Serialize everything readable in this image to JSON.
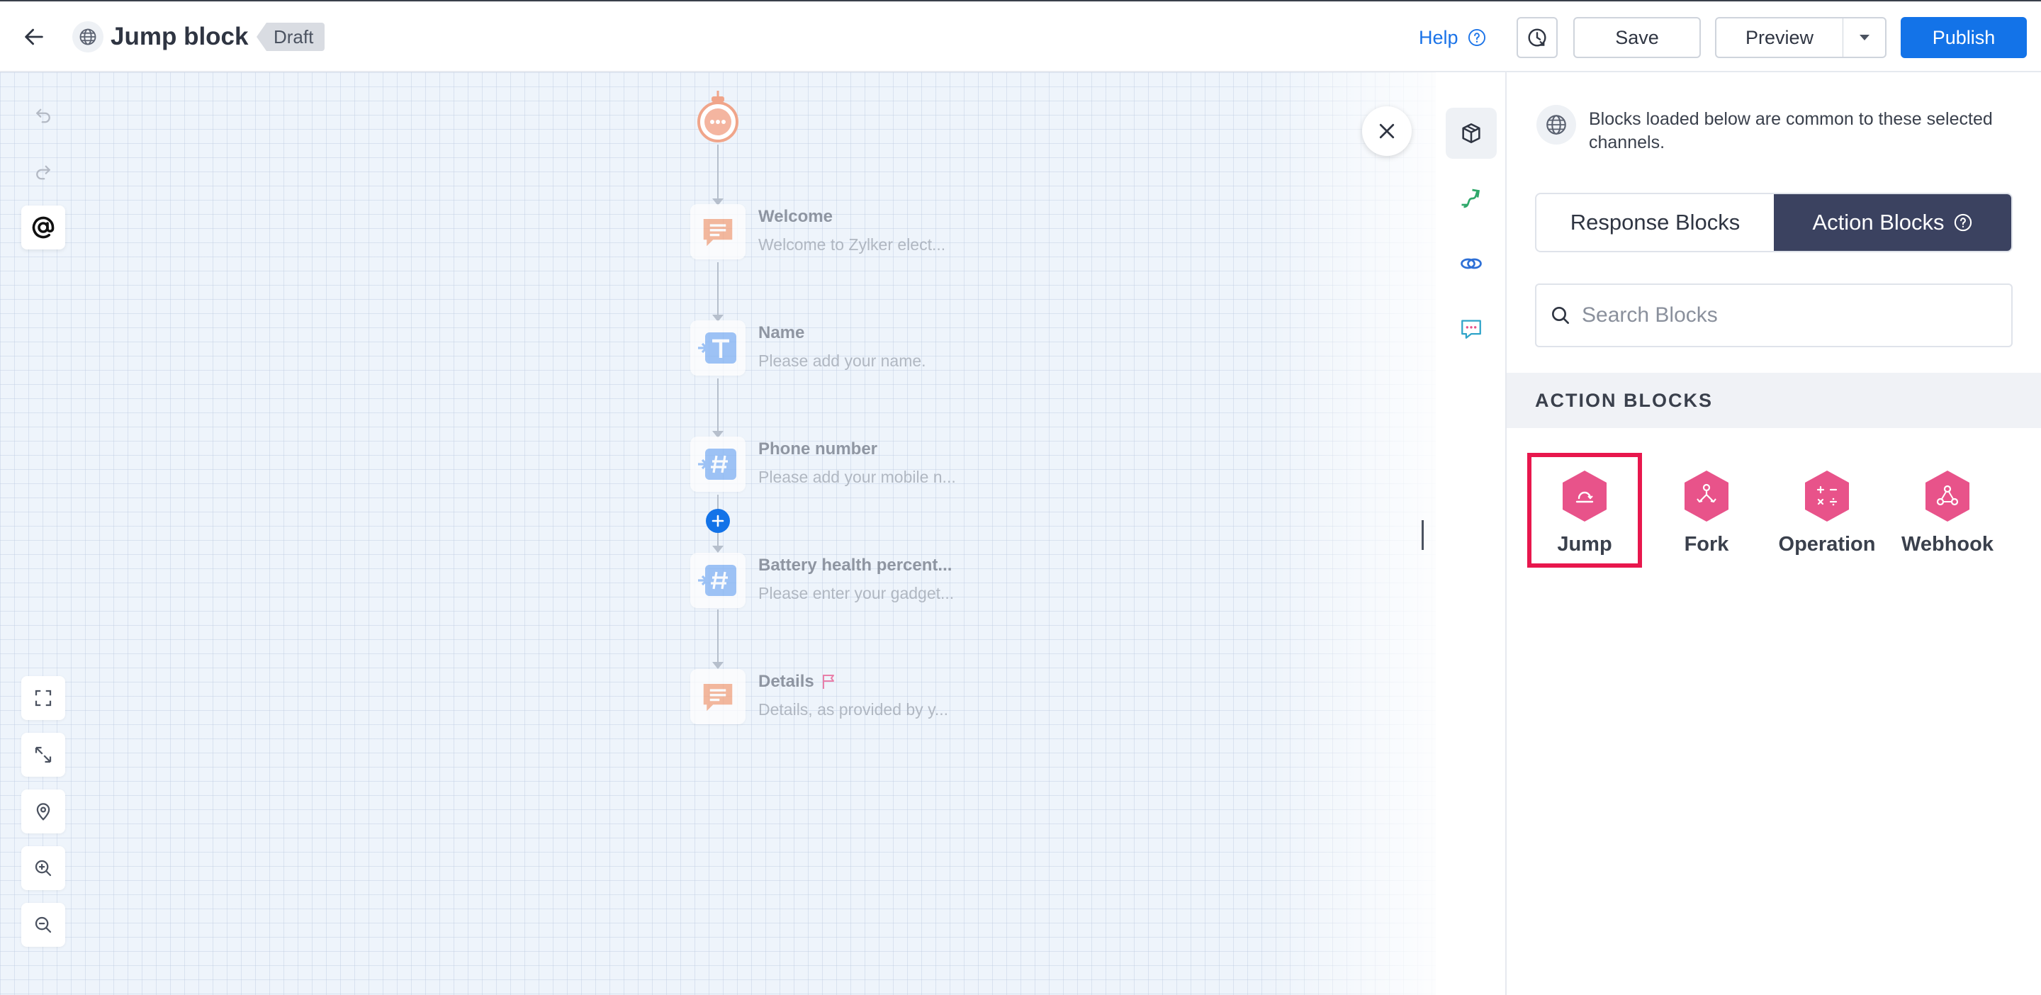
{
  "header": {
    "back_icon": "arrow-left-icon",
    "bot_title": "Jump block",
    "status_tag": "Draft",
    "help_label": "Help",
    "save_label": "Save",
    "preview_label": "Preview",
    "publish_label": "Publish"
  },
  "flow": {
    "nodes": [
      {
        "title": "Welcome",
        "subtitle": "Welcome to Zylker elect...",
        "icon": "message-icon"
      },
      {
        "title": "Name",
        "subtitle": "Please add your name.",
        "icon": "text-input-icon"
      },
      {
        "title": "Phone number",
        "subtitle": "Please add your mobile n...",
        "icon": "number-input-icon"
      },
      {
        "title": "Battery health percent...",
        "subtitle": "Please enter your gadget...",
        "icon": "number-input-icon"
      },
      {
        "title": "Details",
        "subtitle": "Details, as provided by y...",
        "icon": "message-icon"
      }
    ]
  },
  "panel": {
    "info_text": "Blocks loaded below are common to these selected channels.",
    "tabs": [
      {
        "label": "Response Blocks",
        "active": false
      },
      {
        "label": "Action Blocks",
        "active": true
      }
    ],
    "search_placeholder": "Search Blocks",
    "section_title": "ACTION BLOCKS",
    "blocks": [
      {
        "label": "Jump",
        "icon": "jump-icon",
        "highlighted": true
      },
      {
        "label": "Fork",
        "icon": "fork-icon",
        "highlighted": false
      },
      {
        "label": "Operation",
        "icon": "operation-icon",
        "highlighted": false
      },
      {
        "label": "Webhook",
        "icon": "webhook-icon",
        "highlighted": false
      }
    ]
  },
  "colors": {
    "primary": "#1373e8",
    "active_tab": "#3b4260",
    "block_pink": "#e8538a",
    "highlight": "#e8174d",
    "message_orange": "#f4a07a",
    "input_blue": "#7fb0f4"
  }
}
